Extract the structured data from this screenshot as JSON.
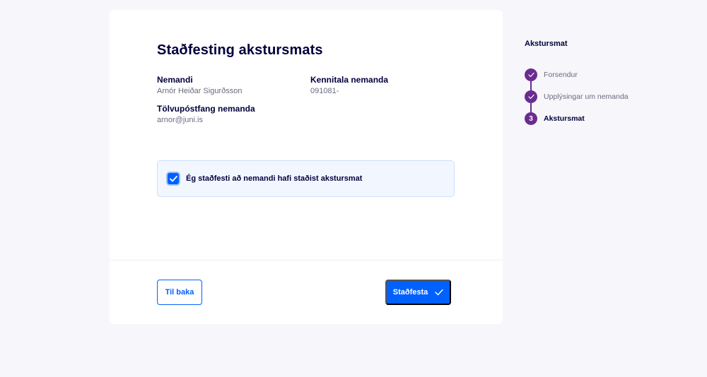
{
  "form": {
    "title": "Staðfesting akstursmats",
    "student_label": "Nemandi",
    "student_value": "Arnór Heiðar Sigurðsson",
    "kennitala_label": "Kennitala nemanda",
    "kennitala_value": "091081-",
    "email_label": "Tölvupóstfang nemanda",
    "email_value": "arnor@juni.is",
    "confirm_label": "Ég staðfesti að nemandi hafi staðist akstursmat",
    "confirm_checked": true
  },
  "actions": {
    "back_label": "Til baka",
    "confirm_label": "Staðfesta"
  },
  "sidebar": {
    "title": "Akstursmat",
    "steps": [
      {
        "label": "Forsendur",
        "state": "done"
      },
      {
        "label": "Upplýsingar um nemanda",
        "state": "done"
      },
      {
        "label": "Akstursmat",
        "state": "active",
        "number": "3"
      }
    ]
  },
  "colors": {
    "primary": "#0061ff",
    "step": "#6a2c91",
    "text": "#00003c",
    "background": "#f7f6fa"
  },
  "icons": {
    "checkbox": "check-icon",
    "confirm_button": "check-icon",
    "step_done": "check-icon"
  }
}
